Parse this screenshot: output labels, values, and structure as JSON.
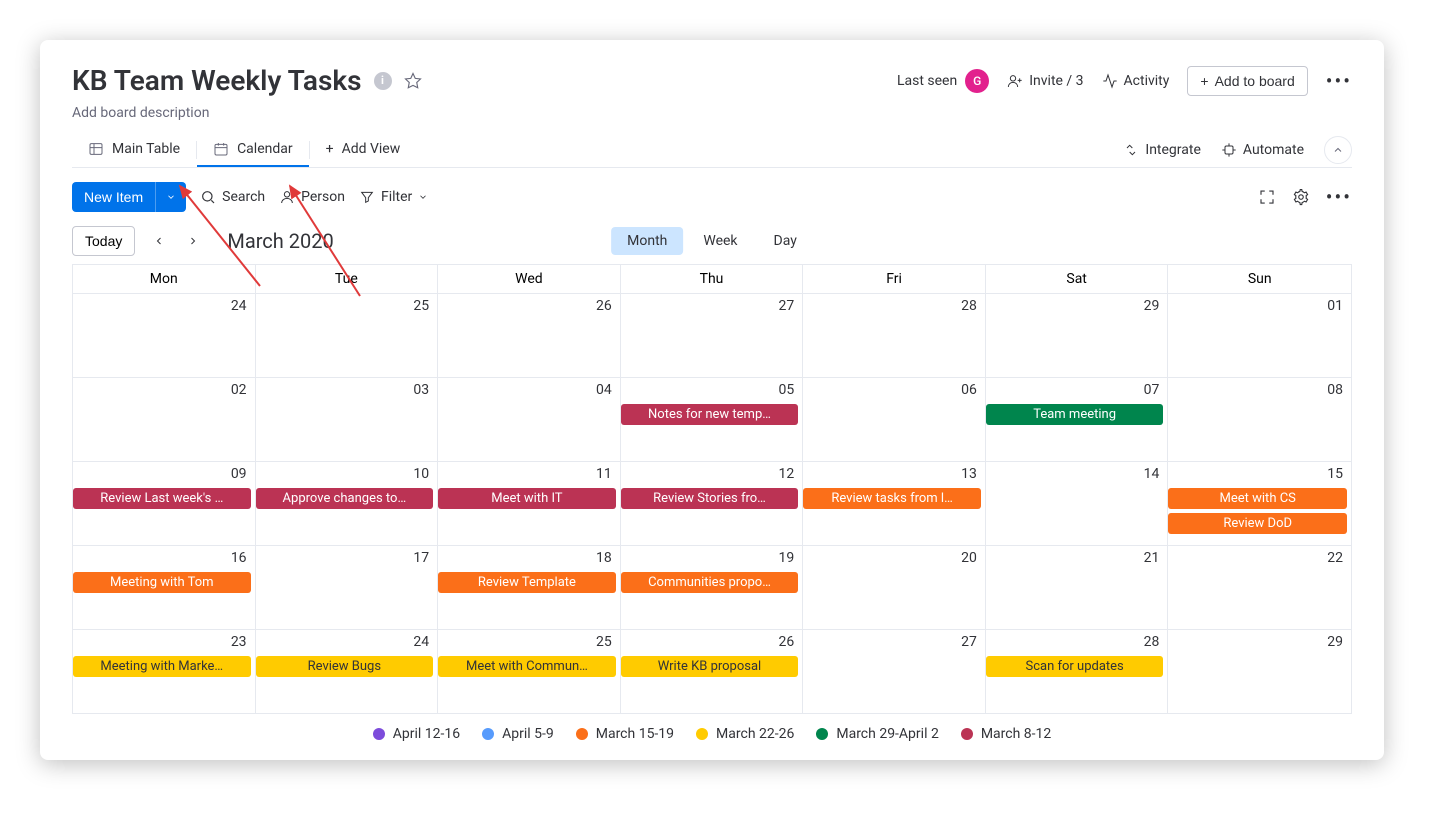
{
  "header": {
    "title": "KB Team Weekly Tasks",
    "description": "Add board description",
    "last_seen_label": "Last seen",
    "avatar_initial": "G",
    "invite_label": "Invite / 3",
    "activity_label": "Activity",
    "add_to_board_label": "Add to board"
  },
  "tabs": {
    "main_table": "Main Table",
    "calendar": "Calendar",
    "add_view": "Add View",
    "integrate": "Integrate",
    "automate": "Automate"
  },
  "toolbar": {
    "new_item": "New Item",
    "search": "Search",
    "person": "Person",
    "filter": "Filter"
  },
  "nav": {
    "today": "Today",
    "month_label": "March 2020",
    "views": {
      "month": "Month",
      "week": "Week",
      "day": "Day"
    }
  },
  "calendar": {
    "headers": [
      "Mon",
      "Tue",
      "Wed",
      "Thu",
      "Fri",
      "Sat",
      "Sun"
    ],
    "weeks": [
      [
        {
          "num": "24",
          "events": []
        },
        {
          "num": "25",
          "events": []
        },
        {
          "num": "26",
          "events": []
        },
        {
          "num": "27",
          "events": []
        },
        {
          "num": "28",
          "events": []
        },
        {
          "num": "29",
          "events": []
        },
        {
          "num": "01",
          "events": []
        }
      ],
      [
        {
          "num": "02",
          "events": []
        },
        {
          "num": "03",
          "events": []
        },
        {
          "num": "04",
          "events": []
        },
        {
          "num": "05",
          "events": [
            {
              "label": "Notes for new temp…",
              "color": "crimson"
            }
          ]
        },
        {
          "num": "06",
          "events": []
        },
        {
          "num": "07",
          "events": [
            {
              "label": "Team meeting",
              "color": "green"
            }
          ]
        },
        {
          "num": "08",
          "events": []
        }
      ],
      [
        {
          "num": "09",
          "events": [
            {
              "label": "Review Last week's …",
              "color": "crimson"
            }
          ]
        },
        {
          "num": "10",
          "events": [
            {
              "label": "Approve changes to…",
              "color": "crimson"
            }
          ]
        },
        {
          "num": "11",
          "events": [
            {
              "label": "Meet with IT",
              "color": "crimson"
            }
          ]
        },
        {
          "num": "12",
          "events": [
            {
              "label": "Review Stories fro…",
              "color": "crimson"
            }
          ]
        },
        {
          "num": "13",
          "events": [
            {
              "label": "Review tasks from l…",
              "color": "orange"
            }
          ]
        },
        {
          "num": "14",
          "events": []
        },
        {
          "num": "15",
          "events": [
            {
              "label": "Meet with CS",
              "color": "orange"
            },
            {
              "label": "Review DoD",
              "color": "orange"
            }
          ]
        }
      ],
      [
        {
          "num": "16",
          "events": [
            {
              "label": "Meeting with Tom",
              "color": "orange"
            }
          ]
        },
        {
          "num": "17",
          "events": []
        },
        {
          "num": "18",
          "events": [
            {
              "label": "Review Template",
              "color": "orange"
            }
          ]
        },
        {
          "num": "19",
          "events": [
            {
              "label": "Communities propo…",
              "color": "orange"
            }
          ]
        },
        {
          "num": "20",
          "events": []
        },
        {
          "num": "21",
          "events": []
        },
        {
          "num": "22",
          "events": []
        }
      ],
      [
        {
          "num": "23",
          "events": [
            {
              "label": "Meeting with Marke…",
              "color": "yellow"
            }
          ]
        },
        {
          "num": "24",
          "events": [
            {
              "label": "Review Bugs",
              "color": "yellow"
            }
          ]
        },
        {
          "num": "25",
          "events": [
            {
              "label": "Meet with Commun…",
              "color": "yellow"
            }
          ]
        },
        {
          "num": "26",
          "events": [
            {
              "label": "Write KB proposal",
              "color": "yellow"
            }
          ]
        },
        {
          "num": "27",
          "events": []
        },
        {
          "num": "28",
          "events": [
            {
              "label": "Scan for updates",
              "color": "yellow"
            }
          ]
        },
        {
          "num": "29",
          "events": []
        }
      ]
    ]
  },
  "legend": [
    {
      "label": "April 12-16",
      "color": "#7d4cdb"
    },
    {
      "label": "April 5-9",
      "color": "#579bfc"
    },
    {
      "label": "March 15-19",
      "color": "#fb6f19"
    },
    {
      "label": "March 22-26",
      "color": "#ffcb00"
    },
    {
      "label": "March 29-April 2",
      "color": "#00854d"
    },
    {
      "label": "March 8-12",
      "color": "#bb3354"
    }
  ]
}
